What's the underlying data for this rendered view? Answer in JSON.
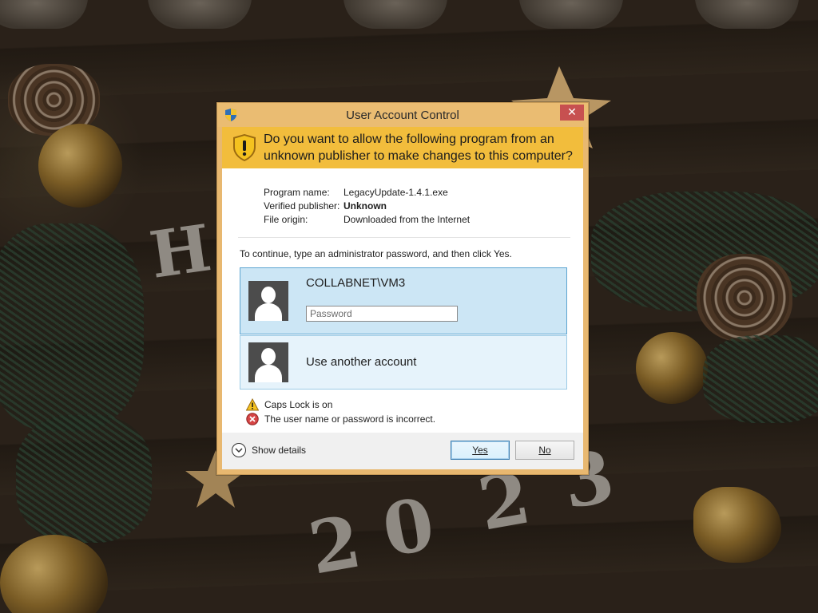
{
  "dialog": {
    "title": "User Account Control",
    "close_glyph": "✕",
    "question": "Do you want to allow the following program from an unknown publisher to make changes to this computer?",
    "info": {
      "program_name_label": "Program name:",
      "program_name_value": "LegacyUpdate-1.4.1.exe",
      "publisher_label": "Verified publisher:",
      "publisher_value": "Unknown",
      "origin_label": "File origin:",
      "origin_value": "Downloaded from the Internet"
    },
    "instruction": "To continue, type an administrator password, and then click Yes.",
    "accounts": [
      {
        "name": "COLLABNET\\VM3",
        "password_placeholder": "Password",
        "password_value": ""
      },
      {
        "name": "Use another account"
      }
    ],
    "messages": {
      "warning": "Caps Lock is on",
      "error": "The user name or password is incorrect."
    },
    "footer": {
      "details_label": "Show details",
      "yes_label": "Yes",
      "no_label": "No"
    }
  },
  "icons": {
    "title": "uac-shield-icon",
    "question": "warning-shield-icon",
    "warning": "warning-triangle-icon",
    "error": "error-icon",
    "details": "chevron-down-icon"
  },
  "colors": {
    "title_bar": "#eabc72",
    "question_band": "#f2bd3c",
    "selected_tile": "#cce6f5",
    "close_button": "#c75050"
  }
}
